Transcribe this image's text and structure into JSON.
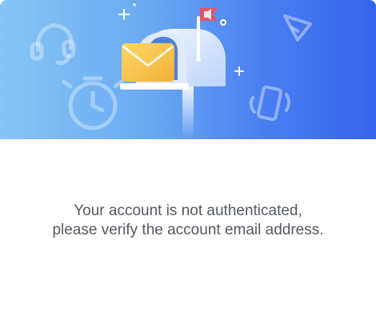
{
  "dialog": {
    "banner": {
      "illustration": "mailbox-with-envelope",
      "decorative_icons": [
        "headset-icon",
        "stopwatch-icon",
        "send-icon",
        "phone-ringing-icon",
        "sparkle-icon",
        "circle-icon"
      ],
      "gradient_colors": [
        "#86c6f5",
        "#3563ec"
      ]
    },
    "message_line1": "Your account is not authenticated,",
    "message_line2": "please verify the account email address."
  },
  "colors": {
    "text": "#555a60",
    "envelope": "#f7c64f",
    "flag": "#e9526b"
  }
}
